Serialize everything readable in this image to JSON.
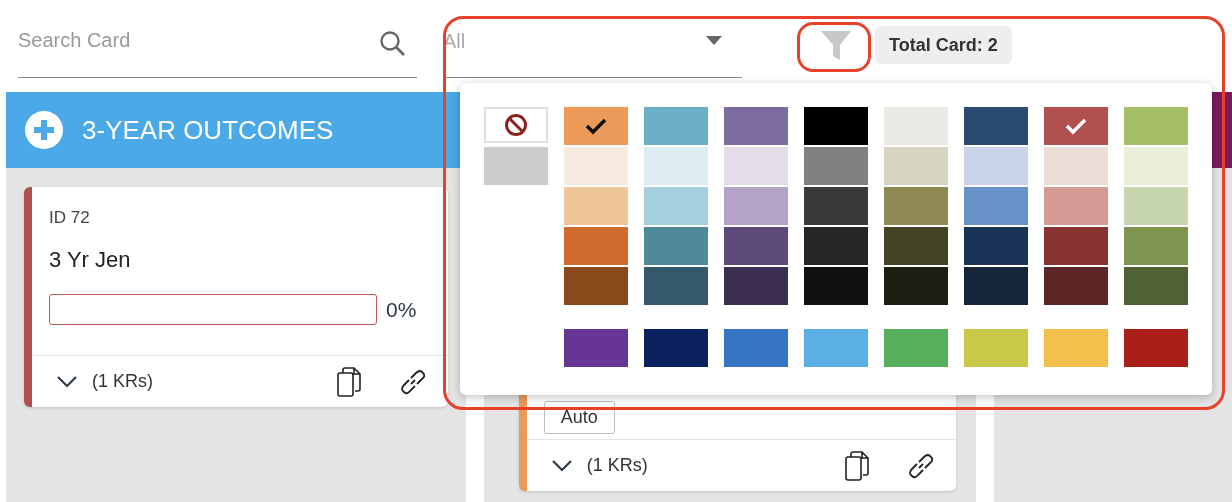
{
  "search": {
    "placeholder": "Search Card"
  },
  "filter_dropdown": {
    "value": "All"
  },
  "total_card": "Total Card: 2",
  "columns": [
    {
      "title": "3-YEAR OUTCOMES",
      "color": "#4aa9e6",
      "cards": [
        {
          "id": "ID 72",
          "title": "3 Yr Jen",
          "color": "#b0514f",
          "progress": {
            "level": 0,
            "reading": "0%"
          },
          "footer": "(1 KRs)"
        }
      ]
    },
    {
      "cards": [
        {
          "color": "#eb9a5a",
          "chip": "Auto",
          "footer": "(1 KRs)"
        }
      ]
    },
    {
      "color": "#7b1a5f"
    }
  ],
  "color_popup": {
    "no_color": {
      "selected": false
    },
    "gray": {
      "color": "#cccccc",
      "selected": false
    },
    "palette": [
      {
        "shades": [
          {
            "color": "#eb9a5a",
            "selected": true
          },
          {
            "color": "#f7ebdf",
            "selected": false
          },
          {
            "color": "#efc59a",
            "selected": false
          },
          {
            "color": "#d06a2e",
            "selected": false
          },
          {
            "color": "#8a4a1c",
            "selected": false
          }
        ]
      },
      {
        "shades": [
          {
            "color": "#6aafc3",
            "selected": false
          },
          {
            "color": "#ddedf2",
            "selected": false
          },
          {
            "color": "#a6cfdd",
            "selected": false
          },
          {
            "color": "#4f8a9b",
            "selected": false
          },
          {
            "color": "#33596a",
            "selected": false
          }
        ]
      },
      {
        "shades": [
          {
            "color": "#7b6b9e",
            "selected": false
          },
          {
            "color": "#e3dde9",
            "selected": false
          },
          {
            "color": "#b3a4c7",
            "selected": false
          },
          {
            "color": "#5d4a7a",
            "selected": false
          },
          {
            "color": "#3d2f4f",
            "selected": false
          }
        ]
      },
      {
        "shades": [
          {
            "color": "#000000",
            "selected": false
          },
          {
            "color": "#808080",
            "selected": false
          },
          {
            "color": "#3a3a3a",
            "selected": false
          },
          {
            "color": "#262626",
            "selected": false
          },
          {
            "color": "#111111",
            "selected": false
          }
        ]
      },
      {
        "shades": [
          {
            "color": "#eaeae4",
            "selected": false
          },
          {
            "color": "#d8d4c2",
            "selected": false
          },
          {
            "color": "#8e8852",
            "selected": false
          },
          {
            "color": "#434326",
            "selected": false
          },
          {
            "color": "#1e1e14",
            "selected": false
          }
        ]
      },
      {
        "shades": [
          {
            "color": "#2b4a6f",
            "selected": false
          },
          {
            "color": "#c9d4ea",
            "selected": false
          },
          {
            "color": "#6793c8",
            "selected": false
          },
          {
            "color": "#1c3358",
            "selected": false
          },
          {
            "color": "#15253a",
            "selected": false
          }
        ]
      },
      {
        "shades": [
          {
            "color": "#b0514f",
            "selected": true
          },
          {
            "color": "#ebdcd8",
            "selected": false
          },
          {
            "color": "#d49a94",
            "selected": false
          },
          {
            "color": "#8a3431",
            "selected": false
          },
          {
            "color": "#5e2626",
            "selected": false
          }
        ]
      },
      {
        "shades": [
          {
            "color": "#a5bf69",
            "selected": false
          },
          {
            "color": "#eaefda",
            "selected": false
          },
          {
            "color": "#c8d6ad",
            "selected": false
          },
          {
            "color": "#7f9550",
            "selected": false
          },
          {
            "color": "#516234",
            "selected": false
          }
        ]
      }
    ],
    "extra": [
      {
        "color": "#673695",
        "selected": false
      },
      {
        "color": "#0b215e",
        "selected": false
      },
      {
        "color": "#3674c4",
        "selected": false
      },
      {
        "color": "#5aafe5",
        "selected": false
      },
      {
        "color": "#58af5b",
        "selected": false
      },
      {
        "color": "#c9c94a",
        "selected": false
      },
      {
        "color": "#f2c04b",
        "selected": false
      },
      {
        "color": "#a91f17",
        "selected": false
      }
    ]
  }
}
